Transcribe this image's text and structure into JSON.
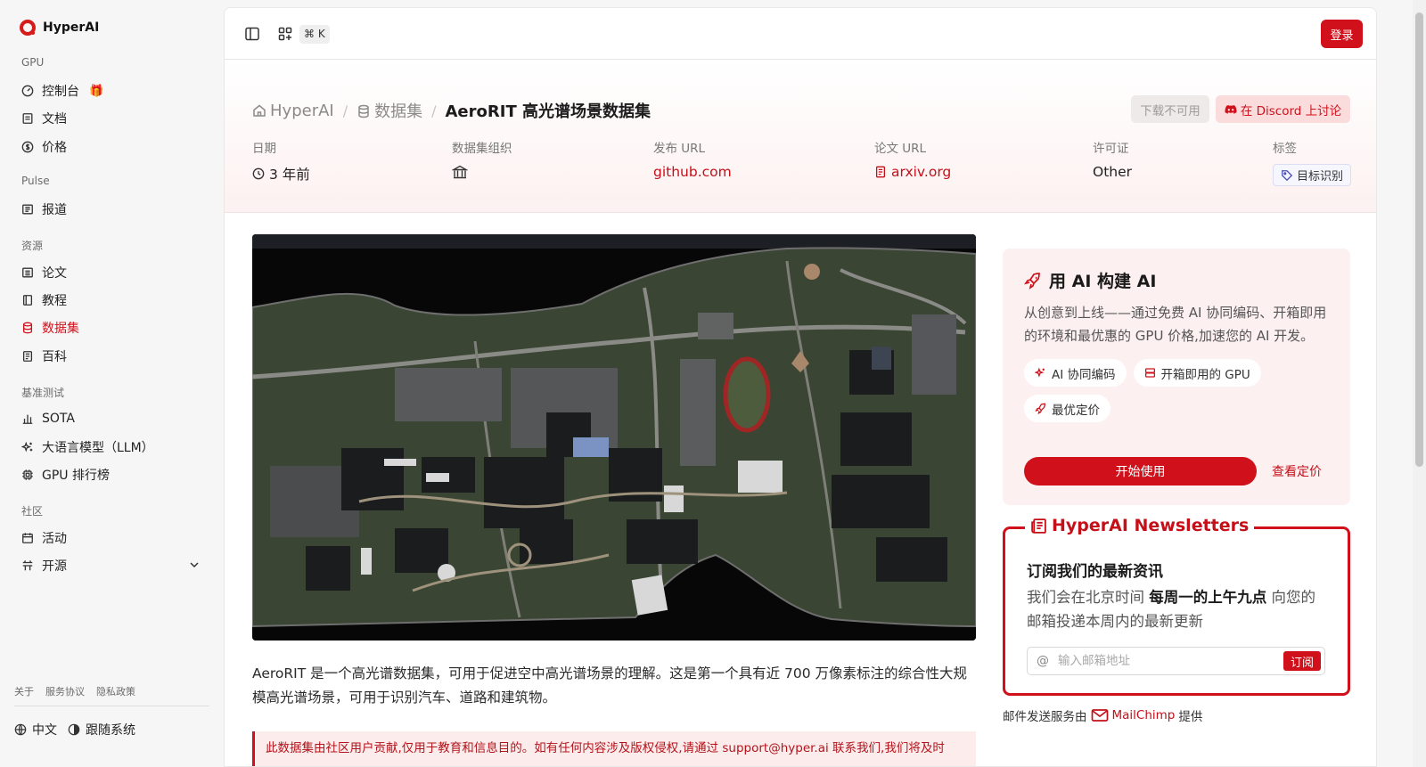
{
  "brand": {
    "name": "HyperAI"
  },
  "sidebar": {
    "sections": [
      {
        "label": "GPU",
        "items": [
          {
            "label": "控制台",
            "badge": "🎁"
          },
          {
            "label": "文档"
          },
          {
            "label": "价格"
          }
        ]
      },
      {
        "label": "Pulse",
        "items": [
          {
            "label": "报道"
          }
        ]
      },
      {
        "label": "资源",
        "items": [
          {
            "label": "论文"
          },
          {
            "label": "教程"
          },
          {
            "label": "数据集",
            "active": true
          },
          {
            "label": "百科"
          }
        ]
      },
      {
        "label": "基准测试",
        "items": [
          {
            "label": "SOTA"
          },
          {
            "label": "大语言模型（LLM）"
          },
          {
            "label": "GPU 排行榜"
          }
        ]
      },
      {
        "label": "社区",
        "items": [
          {
            "label": "活动"
          },
          {
            "label": "开源"
          }
        ]
      }
    ],
    "footer_links": [
      "关于",
      "服务协议",
      "隐私政策"
    ],
    "language": "中文",
    "theme": "跟随系统"
  },
  "topbar": {
    "shortcut": "⌘ K",
    "login_label": "登录"
  },
  "breadcrumb": {
    "home": "HyperAI",
    "section": "数据集",
    "current": "AeroRIT 高光谱场景数据集"
  },
  "actions": {
    "download_label": "下载不可用",
    "discord_label": "在 Discord 上讨论"
  },
  "meta": {
    "date_label": "日期",
    "date_value": "3 年前",
    "org_label": "数据集组织",
    "release_label": "发布 URL",
    "release_value": "github.com",
    "paper_label": "论文 URL",
    "paper_value": "arxiv.org",
    "license_label": "许可证",
    "license_value": "Other",
    "tags_label": "标签",
    "tag_value": "目标识别"
  },
  "description": "AeroRIT 是一个高光谱数据集，可用于促进空中高光谱场景的理解。这是第一个具有近 700 万像素标注的综合性大规模高光谱场景，可用于识别汽车、道路和建筑物。",
  "notice": "此数据集由社区用户贡献,仅用于教育和信息目的。如有任何内容涉及版权侵权,请通过 support@hyper.ai 联系我们,我们将及时",
  "promo": {
    "title": "用 AI 构建 AI",
    "description": "从创意到上线——通过免费 AI 协同编码、开箱即用的环境和最优惠的 GPU 价格,加速您的 AI 开发。",
    "chips": [
      "AI 协同编码",
      "开箱即用的 GPU",
      "最优定价"
    ],
    "start_label": "开始使用",
    "pricing_label": "查看定价"
  },
  "newsletter": {
    "legend": "HyperAI Newsletters",
    "title": "订阅我们的最新资讯",
    "text_before": "我们会在北京时间 ",
    "text_bold": "每周一的上午九点",
    "text_after": " 向您的邮箱投递本周内的最新更新",
    "placeholder": "输入邮箱地址",
    "subscribe_label": "订阅"
  },
  "mailer": {
    "prefix": "邮件发送服务由",
    "brand": "MailChimp",
    "suffix": "提供"
  },
  "colors": {
    "accent": "#d0111b",
    "sidebar_bg": "#f6f6f6"
  }
}
